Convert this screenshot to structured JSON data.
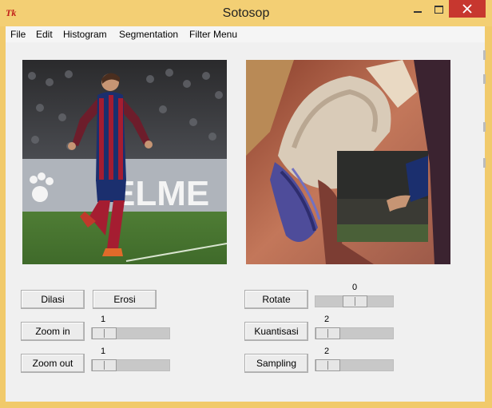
{
  "window": {
    "title": "Sotosop",
    "app_logo": "Tk"
  },
  "menubar": {
    "items": [
      "File",
      "Edit",
      "Histogram",
      "Segmentation",
      "Filter Menu"
    ]
  },
  "images": {
    "left": {
      "content": "soccer player in red and blue kit celebrating on a stadium pitch",
      "background_text": "ELME"
    },
    "right": {
      "content": "close-up of a woman wearing a white hat with a purple feather, with a dark inset patch"
    }
  },
  "buttons": {
    "dilasi": "Dilasi",
    "erosi": "Erosi",
    "zoom_in": "Zoom in",
    "zoom_out": "Zoom out",
    "rotate": "Rotate",
    "kuantisasi": "Kuantisasi",
    "sampling": "Sampling"
  },
  "sliders": {
    "zoom_in": "1",
    "zoom_out": "1",
    "rotate": "0",
    "kuantisasi": "2",
    "sampling": "2"
  },
  "colors": {
    "title_bar": "#f3cf74",
    "close_button": "#c7372f"
  }
}
